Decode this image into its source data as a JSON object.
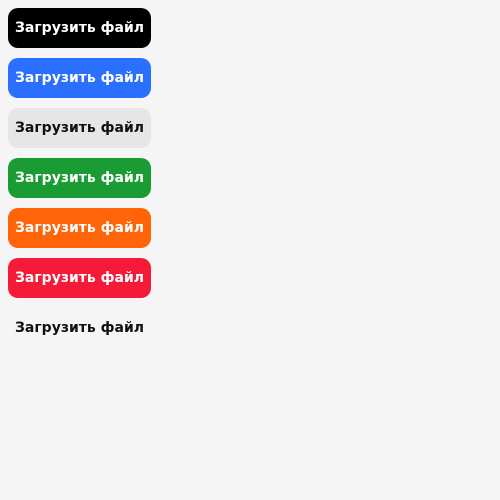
{
  "buttons": [
    {
      "label": "Загрузить файл",
      "variant": "black",
      "background": "#000000",
      "text_color": "#ffffff"
    },
    {
      "label": "Загрузить файл",
      "variant": "blue",
      "background": "#2b6fff",
      "text_color": "#ffffff"
    },
    {
      "label": "Загрузить файл",
      "variant": "gray",
      "background": "#e6e6e6",
      "text_color": "#111111"
    },
    {
      "label": "Загрузить файл",
      "variant": "green",
      "background": "#1b9b33",
      "text_color": "#ffffff"
    },
    {
      "label": "Загрузить файл",
      "variant": "orange",
      "background": "#ff6508",
      "text_color": "#ffffff"
    },
    {
      "label": "Загрузить файл",
      "variant": "red",
      "background": "#f51a38",
      "text_color": "#ffffff"
    },
    {
      "label": "Загрузить файл",
      "variant": "ghost",
      "background": "transparent",
      "text_color": "#111111"
    }
  ]
}
